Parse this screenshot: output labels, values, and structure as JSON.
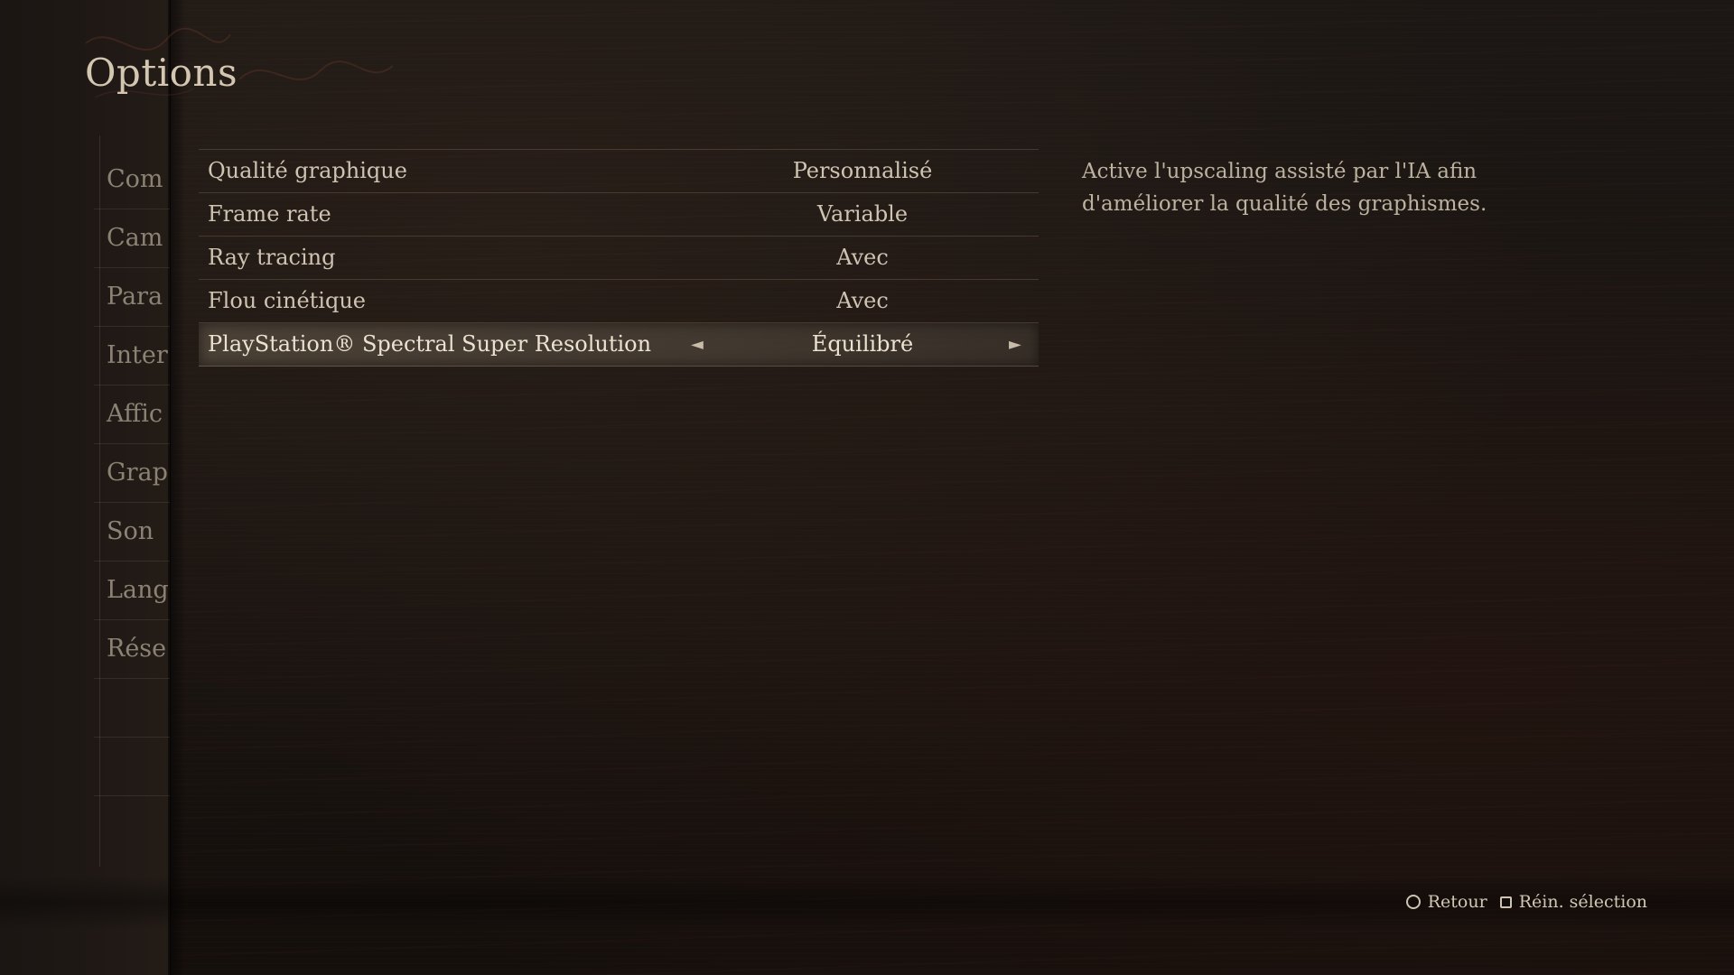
{
  "screen": {
    "title": "Options"
  },
  "sidebar": {
    "items": [
      {
        "label": "Com"
      },
      {
        "label": "Cam"
      },
      {
        "label": "Para"
      },
      {
        "label": "Inter"
      },
      {
        "label": "Affic"
      },
      {
        "label": "Grap"
      },
      {
        "label": "Son"
      },
      {
        "label": "Lang"
      },
      {
        "label": "Rése"
      }
    ]
  },
  "settings": [
    {
      "label": "Qualité graphique",
      "value": "Personnalisé"
    },
    {
      "label": "Frame rate",
      "value": "Variable"
    },
    {
      "label": "Ray tracing",
      "value": "Avec"
    },
    {
      "label": "Flou cinétique",
      "value": "Avec"
    },
    {
      "label": "PlayStation® Spectral Super Resolution",
      "value": "Équilibré",
      "selected": true
    }
  ],
  "arrows": {
    "left": "◄",
    "right": "►"
  },
  "description": "Active l'upscaling assisté par l'IA afin d'améliorer la qualité des graphismes.",
  "footer": {
    "back_label": "Retour",
    "back_icon": "circle-button-icon",
    "reset_label": "Réin. sélection",
    "reset_icon": "square-button-icon"
  },
  "colors": {
    "background": "#1a1512",
    "text": "#cfc4b2",
    "highlight": "#5f5548"
  }
}
